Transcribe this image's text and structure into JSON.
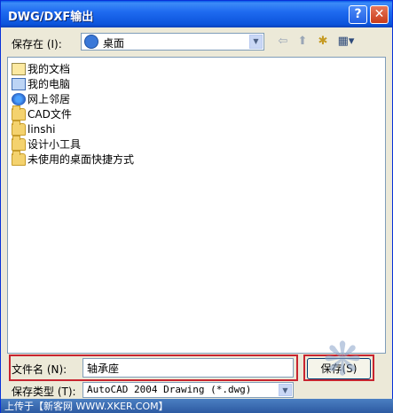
{
  "window": {
    "title": "DWG/DXF输出"
  },
  "titlebar": {
    "help": "?",
    "close": "✕"
  },
  "save_in": {
    "label": "保存在 (I):",
    "value": "桌面"
  },
  "toolbar": {
    "back": "⇦",
    "up": "⬆",
    "new_folder": "✱",
    "view": "▦▾"
  },
  "files": [
    {
      "label": "我的文档",
      "icon": "my-documents-icon"
    },
    {
      "label": "我的电脑",
      "icon": "my-computer-icon"
    },
    {
      "label": "网上邻居",
      "icon": "network-icon"
    },
    {
      "label": "CAD文件",
      "icon": "folder-icon"
    },
    {
      "label": "linshi",
      "icon": "folder-icon"
    },
    {
      "label": "设计小工具",
      "icon": "folder-icon"
    },
    {
      "label": "未使用的桌面快捷方式",
      "icon": "folder-icon"
    }
  ],
  "filename": {
    "label": "文件名 (N):",
    "value": "轴承座"
  },
  "filetype": {
    "label": "保存类型 (T):",
    "value": "AutoCAD 2004 Drawing (*.dwg)"
  },
  "buttons": {
    "save": "保存(S)"
  },
  "watermark": {
    "text": "上传于【新客网 WWW.XKER.COM】"
  },
  "colors": {
    "title_bar": "#0b54dc",
    "highlight_box": "#c8242f",
    "dialog_bg": "#ece9d8"
  }
}
